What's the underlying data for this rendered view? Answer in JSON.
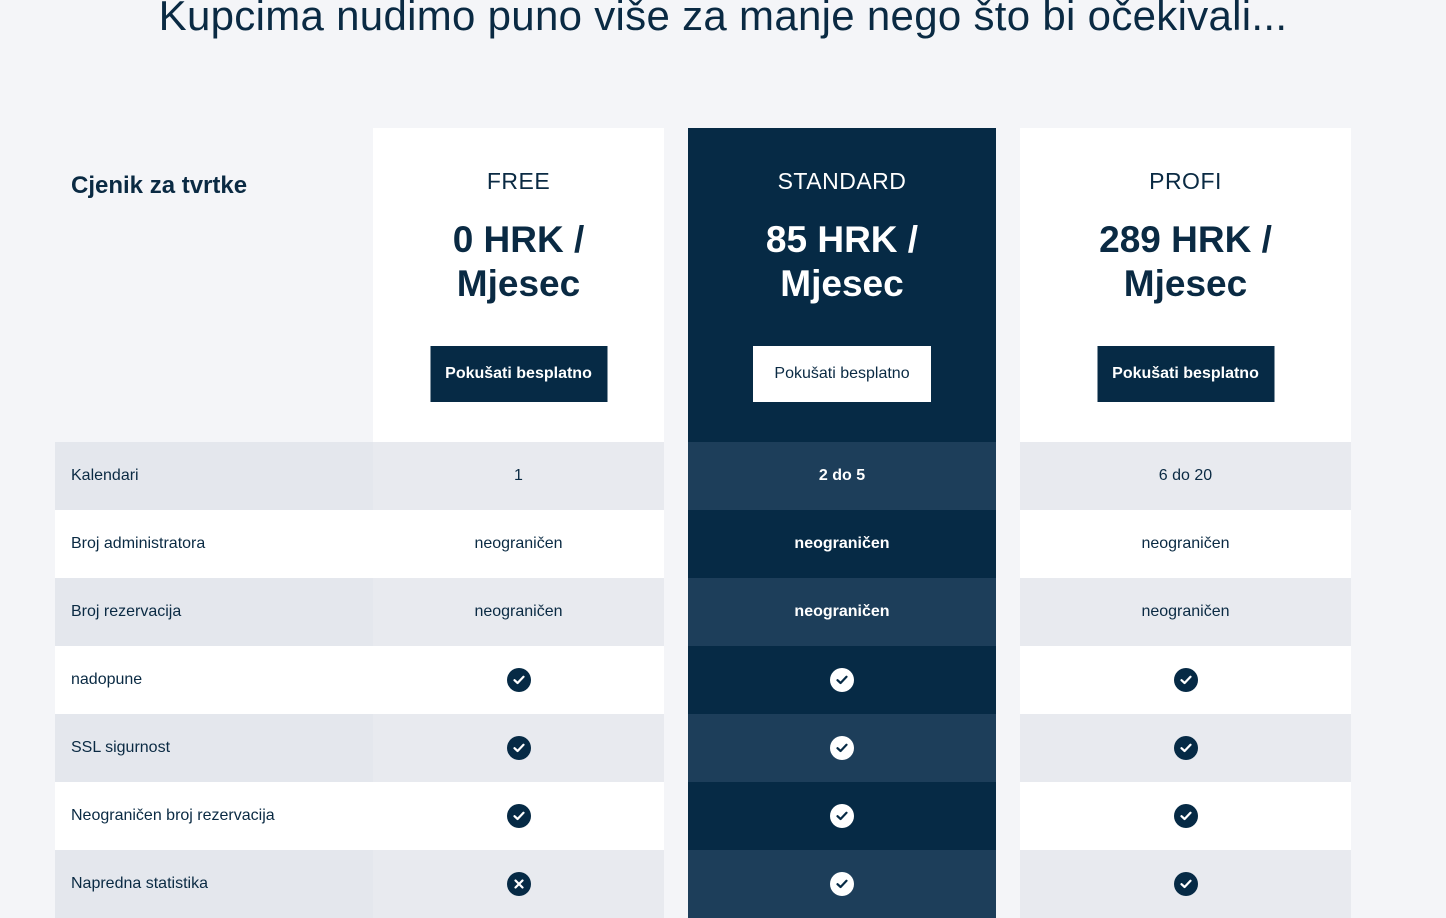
{
  "headline": "Kupcima nudimo puno više za manje nego što bi očekivali...",
  "pricing_title": "Cjenik za tvrtke",
  "plans": [
    {
      "name": "FREE",
      "price_line1": "0 HRK /",
      "price_line2": "Mjesec",
      "button": "Pokušati besplatno"
    },
    {
      "name": "STANDARD",
      "price_line1": "85 HRK /",
      "price_line2": "Mjesec",
      "button": "Pokušati besplatno"
    },
    {
      "name": "PROFI",
      "price_line1": "289 HRK /",
      "price_line2": "Mjesec",
      "button": "Pokušati besplatno"
    }
  ],
  "rows": [
    {
      "label": "Kalendari",
      "free": "1",
      "standard": "2 do 5",
      "profi": "6 do 20"
    },
    {
      "label": "Broj administratora",
      "free": "neograničen",
      "standard": "neograničen",
      "profi": "neograničen"
    },
    {
      "label": "Broj rezervacija",
      "free": "neograničen",
      "standard": "neograničen",
      "profi": "neograničen"
    },
    {
      "label": "nadopune",
      "free": "check",
      "standard": "check",
      "profi": "check"
    },
    {
      "label": "SSL sigurnost",
      "free": "check",
      "standard": "check",
      "profi": "check"
    },
    {
      "label": "Neograničen broj rezervacija",
      "free": "check",
      "standard": "check",
      "profi": "check"
    },
    {
      "label": "Napredna statistika",
      "free": "cross",
      "standard": "check",
      "profi": "check"
    }
  ],
  "colors": {
    "navy": "#062a45",
    "text": "#0a2a43",
    "background": "#f4f5f8"
  },
  "icons": {
    "check": "check-circle-icon",
    "cross": "cross-circle-icon"
  }
}
